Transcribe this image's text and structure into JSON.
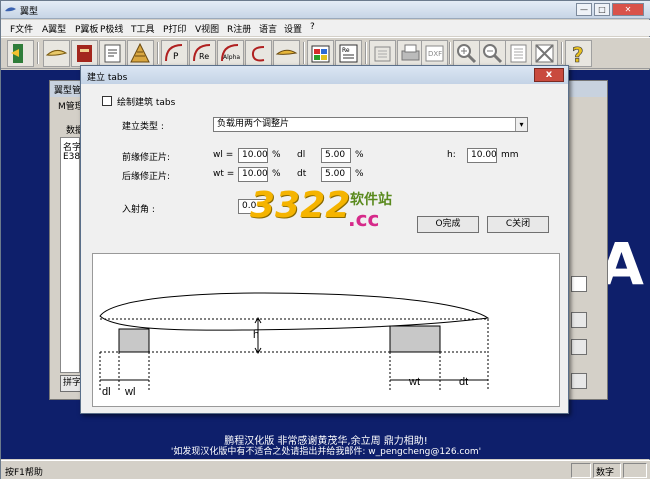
{
  "window": {
    "title": "翼型"
  },
  "menu": [
    "F文件",
    "A翼型",
    "P翼板",
    "P极线",
    "T工具",
    "P打印",
    "V视图",
    "R注册",
    "语言",
    "设置",
    "?"
  ],
  "bg_window": {
    "title": "翼型管",
    "subtitle": "M管理",
    "label_data": "数据",
    "list_header": "名字",
    "list_item": "E387",
    "bottom_button": "拼字"
  },
  "background_letter": "A",
  "dialog": {
    "title": "建立 tabs",
    "close_label": "x",
    "checkbox_label": "绘制建筑 tabs",
    "type_label": "建立类型 :",
    "type_value": "负载用两个调整片",
    "front_label": "前缘修正片:",
    "rear_label": "后缘修正片:",
    "wl_label": "wl =",
    "wl_value": "10.00",
    "wt_label": "wt =",
    "wt_value": "10.00",
    "pct": "%",
    "dl_label": "dl",
    "dl_value": "5.00",
    "dt_label": "dt",
    "dt_value": "5.00",
    "h_label": "h:",
    "h_value": "10.00",
    "h_unit": "mm",
    "aoa_label": "入射角 :",
    "aoa_value": "0.0",
    "ok_label": "O完成",
    "close_btn_label": "C关闭"
  },
  "watermark": {
    "number": "3322",
    "cn": "软件站",
    "domain": ".cc"
  },
  "diagram": {
    "h": "h",
    "dl": "dl",
    "wl": "wl",
    "wt": "wt",
    "dt": "dt"
  },
  "footer": {
    "line1": "鹏程汉化版 非常感谢黄茂华,余立周 鼎力相助!",
    "line2": "'如发现汉化版中有不适合之处请指出并给我邮件: w_pengcheng@126.com'"
  },
  "status": {
    "help": "按F1帮助",
    "mode": "数字"
  }
}
